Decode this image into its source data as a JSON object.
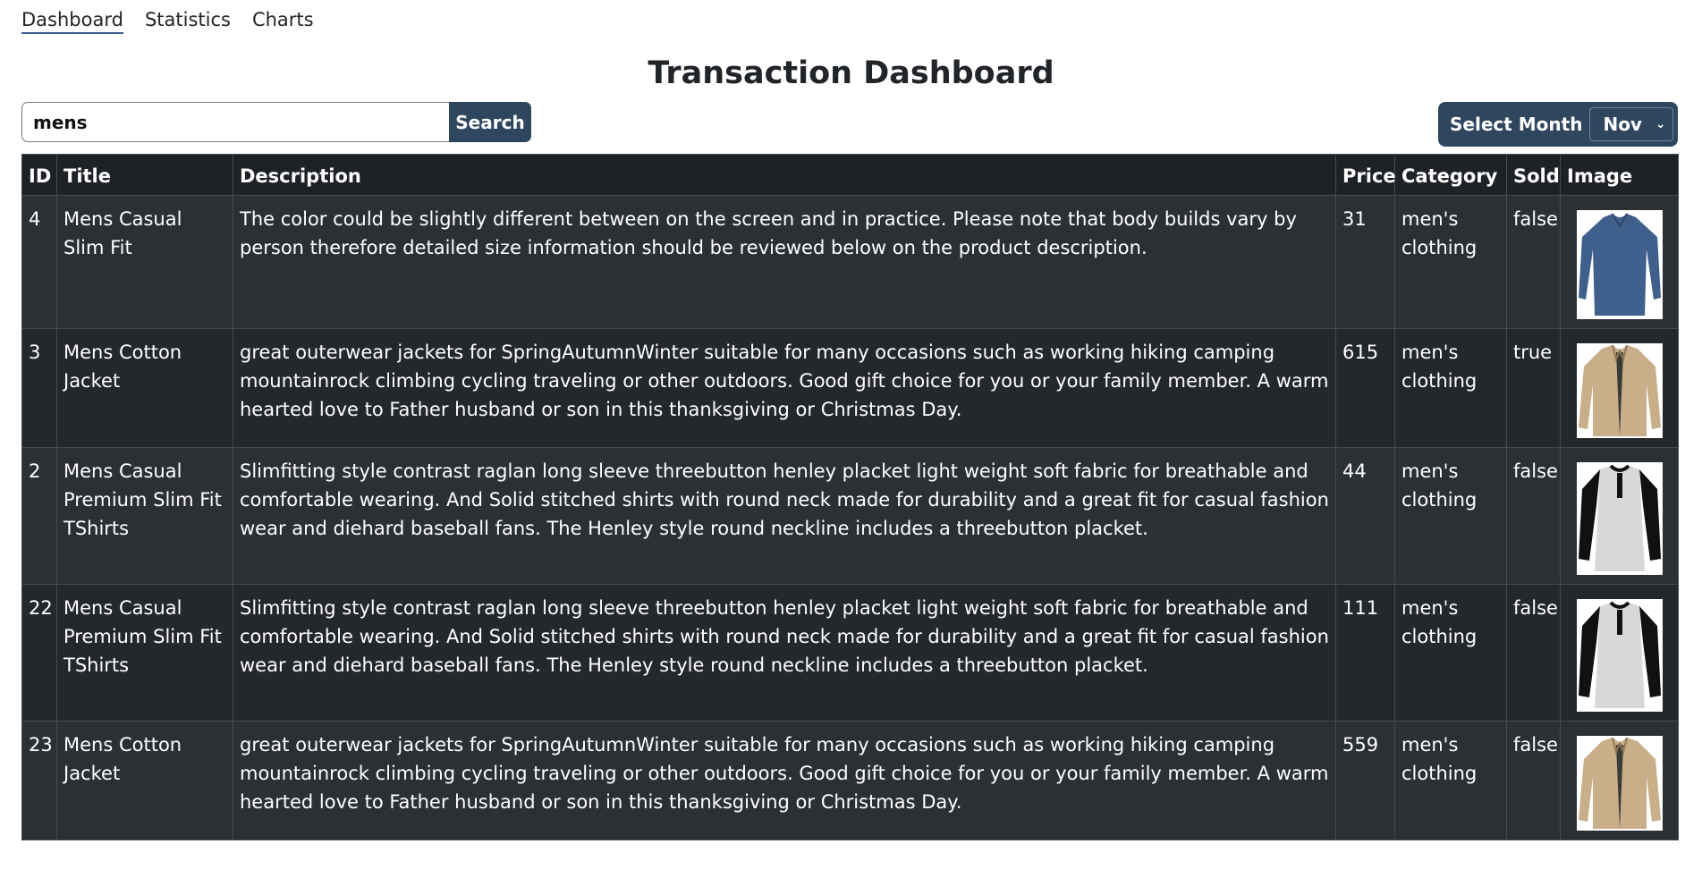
{
  "nav": {
    "items": [
      {
        "label": "Dashboard",
        "active": true
      },
      {
        "label": "Statistics",
        "active": false
      },
      {
        "label": "Charts",
        "active": false
      }
    ]
  },
  "page_title": "Transaction Dashboard",
  "search": {
    "value": "mens",
    "button_label": "Search"
  },
  "month_select": {
    "label": "Select Month",
    "value": "Nov"
  },
  "colors": {
    "accent": "#2f465f",
    "table_bg": "#24272b",
    "table_row_alt": "#2c3034"
  },
  "table": {
    "headers": [
      "ID",
      "Title",
      "Description",
      "Price",
      "Category",
      "Sold",
      "Image"
    ],
    "rows": [
      {
        "id": "4",
        "title": "Mens Casual Slim Fit",
        "description": "The color could be slightly different between on the screen and in practice. Please note that body builds vary by person therefore detailed size information should be reviewed below on the product description.",
        "price": "31",
        "category": "men's clothing",
        "sold": "false",
        "image": "blue-long-sleeve-shirt"
      },
      {
        "id": "3",
        "title": "Mens Cotton Jacket",
        "description": "great outerwear jackets for SpringAutumnWinter suitable for many occasions such as working hiking camping mountainrock climbing cycling traveling or other outdoors. Good gift choice for you or your family member. A warm hearted love to Father husband or son in this thanksgiving or Christmas Day.",
        "price": "615",
        "category": "men's clothing",
        "sold": "true",
        "image": "khaki-jacket"
      },
      {
        "id": "2",
        "title": "Mens Casual Premium Slim Fit TShirts",
        "description": "Slimfitting style contrast raglan long sleeve threebutton henley placket light weight soft fabric for breathable and comfortable wearing. And Solid stitched shirts with round neck made for durability and a great fit for casual fashion wear and diehard baseball fans. The Henley style round neckline includes a threebutton placket.",
        "price": "44",
        "category": "men's clothing",
        "sold": "false",
        "image": "raglan-henley-shirt"
      },
      {
        "id": "22",
        "title": "Mens Casual Premium Slim Fit TShirts",
        "description": "Slimfitting style contrast raglan long sleeve threebutton henley placket light weight soft fabric for breathable and comfortable wearing. And Solid stitched shirts with round neck made for durability and a great fit for casual fashion wear and diehard baseball fans. The Henley style round neckline includes a threebutton placket.",
        "price": "111",
        "category": "men's clothing",
        "sold": "false",
        "image": "raglan-henley-shirt"
      },
      {
        "id": "23",
        "title": "Mens Cotton Jacket",
        "description": "great outerwear jackets for SpringAutumnWinter suitable for many occasions such as working hiking camping mountainrock climbing cycling traveling or other outdoors. Good gift choice for you or your family member. A warm hearted love to Father husband or son in this thanksgiving or Christmas Day.",
        "price": "559",
        "category": "men's clothing",
        "sold": "false",
        "image": "khaki-jacket"
      }
    ]
  }
}
